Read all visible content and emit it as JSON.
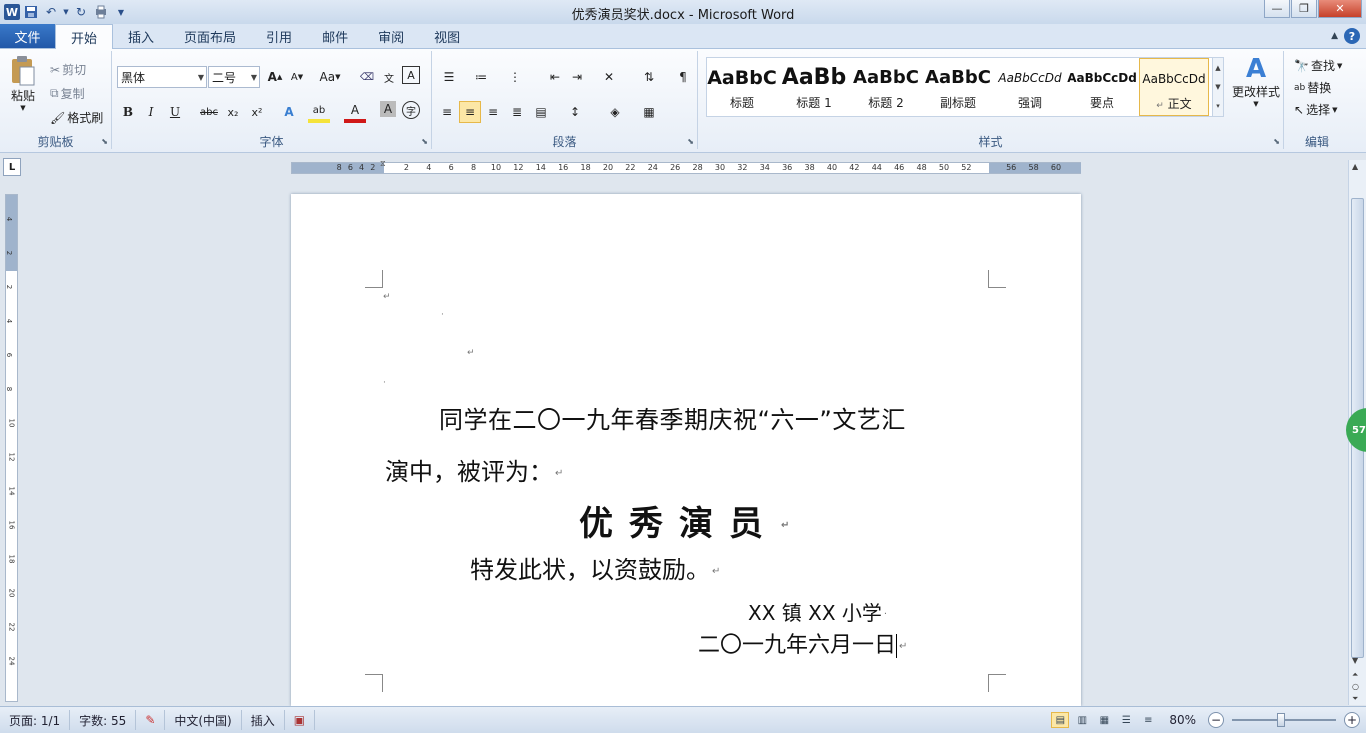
{
  "window": {
    "title": "优秀演员奖状.docx - Microsoft Word",
    "app_icon": "W"
  },
  "tabs": {
    "file": "文件",
    "items": [
      "开始",
      "插入",
      "页面布局",
      "引用",
      "邮件",
      "审阅",
      "视图"
    ],
    "active": "开始"
  },
  "clipboard": {
    "paste": "粘贴",
    "cut": "剪切",
    "copy": "复制",
    "format_painter": "格式刷",
    "label": "剪贴板"
  },
  "font": {
    "name": "黑体",
    "size": "二号",
    "label": "字体",
    "bold": "B",
    "italic": "I",
    "underline": "U",
    "strike": "abc",
    "sub": "x₂",
    "sup": "x²",
    "grow": "A",
    "shrink": "A",
    "case": "Aa",
    "font_color_letter": "A",
    "highlight_letter": "ab"
  },
  "paragraph": {
    "label": "段落"
  },
  "styles": {
    "label": "样式",
    "items": [
      {
        "sample": "AaBbC",
        "name": "标题"
      },
      {
        "sample": "AaBb",
        "name": "标题 1"
      },
      {
        "sample": "AaBbC",
        "name": "标题 2"
      },
      {
        "sample": "AaBbC",
        "name": "副标题"
      },
      {
        "sample": "AaBbCcDd",
        "name": "强调"
      },
      {
        "sample": "AaBbCcDd",
        "name": "要点"
      },
      {
        "sample": "AaBbCcDd",
        "name": "正文"
      }
    ],
    "change_styles": "更改样式"
  },
  "editing": {
    "find": "查找",
    "replace": "替换",
    "select": "选择",
    "label": "编辑"
  },
  "ruler": {
    "numbers": [
      "8",
      "6",
      "4",
      "2",
      "2",
      "4",
      "6",
      "8",
      "10",
      "12",
      "14",
      "16",
      "18",
      "20",
      "22",
      "24",
      "26",
      "28",
      "30",
      "32",
      "34",
      "36",
      "38",
      "40",
      "42",
      "44",
      "46",
      "48",
      "50",
      "52",
      "56",
      "58",
      "60"
    ],
    "vnumbers": [
      "4",
      "2",
      "2",
      "4",
      "6",
      "8",
      "10",
      "12",
      "14",
      "16",
      "18",
      "20",
      "22",
      "24"
    ]
  },
  "document": {
    "line1": "同学在二〇一九年春季期庆祝“六一”文艺汇",
    "line2": "演中，被评为：",
    "title": "优秀演员",
    "line4": "特发此状，以资鼓励。",
    "school": "XX 镇 XX 小学",
    "date": "二〇一九年六月一日",
    "return_mark": "↵"
  },
  "scroll_badge": "57",
  "statusbar": {
    "page": "页面: 1/1",
    "words": "字数: 55",
    "language": "中文(中国)",
    "mode": "插入",
    "zoom": "80%",
    "zoom_level": 0.8
  }
}
